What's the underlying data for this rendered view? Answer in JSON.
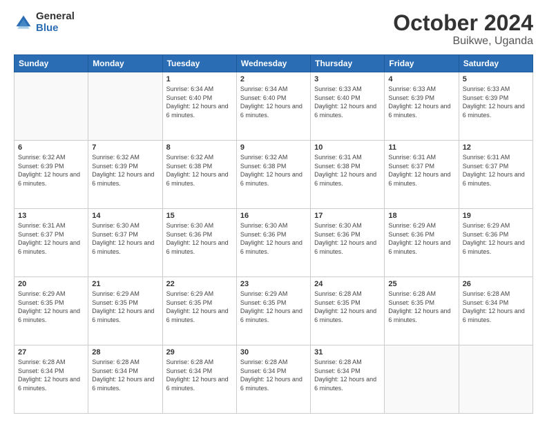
{
  "logo": {
    "general": "General",
    "blue": "Blue"
  },
  "title": "October 2024",
  "subtitle": "Buikwe, Uganda",
  "days_header": [
    "Sunday",
    "Monday",
    "Tuesday",
    "Wednesday",
    "Thursday",
    "Friday",
    "Saturday"
  ],
  "weeks": [
    [
      {
        "day": "",
        "info": ""
      },
      {
        "day": "",
        "info": ""
      },
      {
        "day": "1",
        "info": "Sunrise: 6:34 AM\nSunset: 6:40 PM\nDaylight: 12 hours and 6 minutes."
      },
      {
        "day": "2",
        "info": "Sunrise: 6:34 AM\nSunset: 6:40 PM\nDaylight: 12 hours and 6 minutes."
      },
      {
        "day": "3",
        "info": "Sunrise: 6:33 AM\nSunset: 6:40 PM\nDaylight: 12 hours and 6 minutes."
      },
      {
        "day": "4",
        "info": "Sunrise: 6:33 AM\nSunset: 6:39 PM\nDaylight: 12 hours and 6 minutes."
      },
      {
        "day": "5",
        "info": "Sunrise: 6:33 AM\nSunset: 6:39 PM\nDaylight: 12 hours and 6 minutes."
      }
    ],
    [
      {
        "day": "6",
        "info": "Sunrise: 6:32 AM\nSunset: 6:39 PM\nDaylight: 12 hours and 6 minutes."
      },
      {
        "day": "7",
        "info": "Sunrise: 6:32 AM\nSunset: 6:39 PM\nDaylight: 12 hours and 6 minutes."
      },
      {
        "day": "8",
        "info": "Sunrise: 6:32 AM\nSunset: 6:38 PM\nDaylight: 12 hours and 6 minutes."
      },
      {
        "day": "9",
        "info": "Sunrise: 6:32 AM\nSunset: 6:38 PM\nDaylight: 12 hours and 6 minutes."
      },
      {
        "day": "10",
        "info": "Sunrise: 6:31 AM\nSunset: 6:38 PM\nDaylight: 12 hours and 6 minutes."
      },
      {
        "day": "11",
        "info": "Sunrise: 6:31 AM\nSunset: 6:37 PM\nDaylight: 12 hours and 6 minutes."
      },
      {
        "day": "12",
        "info": "Sunrise: 6:31 AM\nSunset: 6:37 PM\nDaylight: 12 hours and 6 minutes."
      }
    ],
    [
      {
        "day": "13",
        "info": "Sunrise: 6:31 AM\nSunset: 6:37 PM\nDaylight: 12 hours and 6 minutes."
      },
      {
        "day": "14",
        "info": "Sunrise: 6:30 AM\nSunset: 6:37 PM\nDaylight: 12 hours and 6 minutes."
      },
      {
        "day": "15",
        "info": "Sunrise: 6:30 AM\nSunset: 6:36 PM\nDaylight: 12 hours and 6 minutes."
      },
      {
        "day": "16",
        "info": "Sunrise: 6:30 AM\nSunset: 6:36 PM\nDaylight: 12 hours and 6 minutes."
      },
      {
        "day": "17",
        "info": "Sunrise: 6:30 AM\nSunset: 6:36 PM\nDaylight: 12 hours and 6 minutes."
      },
      {
        "day": "18",
        "info": "Sunrise: 6:29 AM\nSunset: 6:36 PM\nDaylight: 12 hours and 6 minutes."
      },
      {
        "day": "19",
        "info": "Sunrise: 6:29 AM\nSunset: 6:36 PM\nDaylight: 12 hours and 6 minutes."
      }
    ],
    [
      {
        "day": "20",
        "info": "Sunrise: 6:29 AM\nSunset: 6:35 PM\nDaylight: 12 hours and 6 minutes."
      },
      {
        "day": "21",
        "info": "Sunrise: 6:29 AM\nSunset: 6:35 PM\nDaylight: 12 hours and 6 minutes."
      },
      {
        "day": "22",
        "info": "Sunrise: 6:29 AM\nSunset: 6:35 PM\nDaylight: 12 hours and 6 minutes."
      },
      {
        "day": "23",
        "info": "Sunrise: 6:29 AM\nSunset: 6:35 PM\nDaylight: 12 hours and 6 minutes."
      },
      {
        "day": "24",
        "info": "Sunrise: 6:28 AM\nSunset: 6:35 PM\nDaylight: 12 hours and 6 minutes."
      },
      {
        "day": "25",
        "info": "Sunrise: 6:28 AM\nSunset: 6:35 PM\nDaylight: 12 hours and 6 minutes."
      },
      {
        "day": "26",
        "info": "Sunrise: 6:28 AM\nSunset: 6:34 PM\nDaylight: 12 hours and 6 minutes."
      }
    ],
    [
      {
        "day": "27",
        "info": "Sunrise: 6:28 AM\nSunset: 6:34 PM\nDaylight: 12 hours and 6 minutes."
      },
      {
        "day": "28",
        "info": "Sunrise: 6:28 AM\nSunset: 6:34 PM\nDaylight: 12 hours and 6 minutes."
      },
      {
        "day": "29",
        "info": "Sunrise: 6:28 AM\nSunset: 6:34 PM\nDaylight: 12 hours and 6 minutes."
      },
      {
        "day": "30",
        "info": "Sunrise: 6:28 AM\nSunset: 6:34 PM\nDaylight: 12 hours and 6 minutes."
      },
      {
        "day": "31",
        "info": "Sunrise: 6:28 AM\nSunset: 6:34 PM\nDaylight: 12 hours and 6 minutes."
      },
      {
        "day": "",
        "info": ""
      },
      {
        "day": "",
        "info": ""
      }
    ]
  ]
}
